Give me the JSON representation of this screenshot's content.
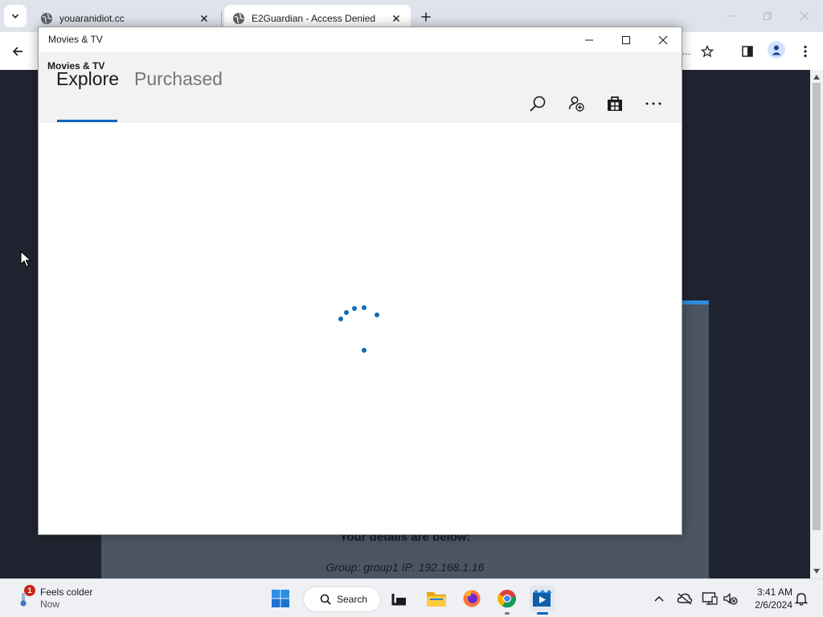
{
  "browser": {
    "tabs": [
      {
        "title": "youaranidiot.cc",
        "active": false
      },
      {
        "title": "E2Guardian - Access Denied",
        "active": true
      }
    ],
    "omnibox_tail": "t...",
    "window_controls": [
      "minimize",
      "restore",
      "close"
    ]
  },
  "page": {
    "details_title": "Your details are below:",
    "details_line": "Group: group1   IP: 192.168.1.16"
  },
  "app": {
    "window_title": "Movies & TV",
    "app_name": "Movies & TV",
    "tabs": [
      {
        "label": "Explore",
        "selected": true
      },
      {
        "label": "Purchased",
        "selected": false
      }
    ],
    "header_buttons": [
      "search-icon",
      "add-person-icon",
      "store-icon",
      "more-icon"
    ],
    "state": "loading",
    "accent_color": "#0067b8"
  },
  "taskbar": {
    "weather": {
      "condition": "Feels colder",
      "time": "Now",
      "badge": "1"
    },
    "search_label": "Search",
    "pinned": [
      "start",
      "search",
      "file-explorer",
      "files",
      "firefox",
      "chrome",
      "movies-tv"
    ],
    "clock": {
      "time": "3:41 AM",
      "date": "2/6/2024"
    }
  }
}
